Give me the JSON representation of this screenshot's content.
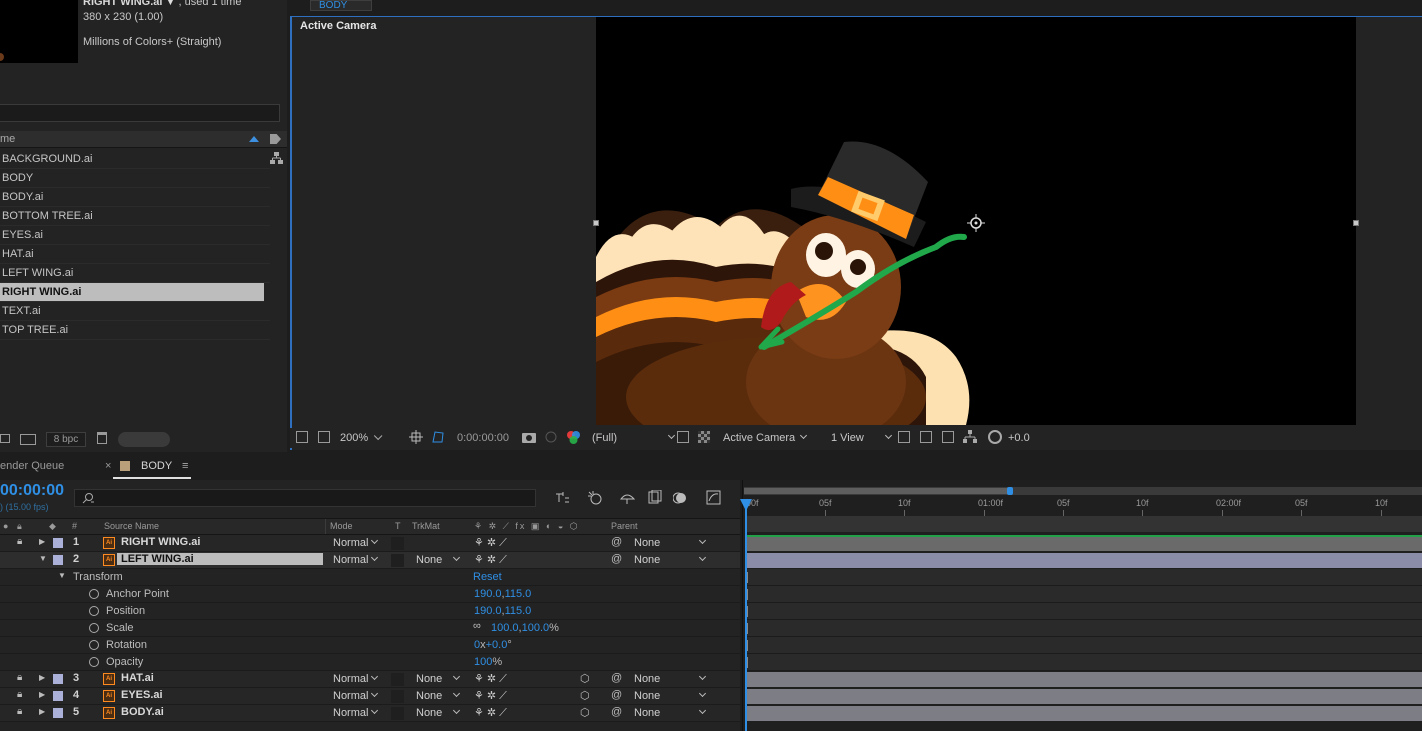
{
  "project": {
    "selected_name": "RIGHT WING.ai",
    "used_text": ", used 1 time",
    "dimensions": "380 x 230 (1.00)",
    "colors": "Millions of Colors+ (Straight)",
    "column_name": "me",
    "items": [
      "BACKGROUND.ai",
      "BODY",
      "BODY.ai",
      "BOTTOM TREE.ai",
      "EYES.ai",
      "HAT.ai",
      "LEFT WING.ai",
      "RIGHT WING.ai",
      "TEXT.ai",
      "TOP TREE.ai"
    ],
    "bpc": "8 bpc"
  },
  "viewer": {
    "comp_tab": "BODY",
    "view_label": "Active Camera",
    "zoom": "200%",
    "timecode": "0:00:00:00",
    "resolution": "(Full)",
    "camera": "Active Camera",
    "views": "1 View",
    "exposure": "+0.0"
  },
  "timeline": {
    "render_queue_tab": "ender Queue",
    "close_glyph": "×",
    "comp_tab": "BODY",
    "menu_glyph": "≡",
    "timecode": "00:00:00",
    "fps": ") (15.00 fps)",
    "columns": {
      "num": "#",
      "source": "Source Name",
      "mode": "Mode",
      "t": "T",
      "trkmat": "TrkMat",
      "parent": "Parent"
    },
    "layers": [
      {
        "num": "1",
        "name": "RIGHT WING.ai",
        "mode": "Normal",
        "trkmat": "",
        "parent": "None"
      },
      {
        "num": "2",
        "name": "LEFT WING.ai",
        "mode": "Normal",
        "trkmat": "None",
        "parent": "None"
      },
      {
        "num": "3",
        "name": "HAT.ai",
        "mode": "Normal",
        "trkmat": "None",
        "parent": "None"
      },
      {
        "num": "4",
        "name": "EYES.ai",
        "mode": "Normal",
        "trkmat": "None",
        "parent": "None"
      },
      {
        "num": "5",
        "name": "BODY.ai",
        "mode": "Normal",
        "trkmat": "None",
        "parent": "None"
      }
    ],
    "transform": {
      "label": "Transform",
      "reset": "Reset",
      "anchor_label": "Anchor Point",
      "anchor_x": "190.0",
      "anchor_y": "115.0",
      "position_label": "Position",
      "position_x": "190.0",
      "position_y": "115.0",
      "scale_label": "Scale",
      "scale_x": "100.0",
      "scale_y": "100.0",
      "scale_unit": "%",
      "rotation_label": "Rotation",
      "rotation_turns": "0",
      "rotation_x": "x",
      "rotation_deg": "+0.0",
      "rotation_unit": "°",
      "opacity_label": "Opacity",
      "opacity": "100",
      "opacity_unit": "%"
    },
    "ruler": [
      "00f",
      "05f",
      "10f",
      "01:00f",
      "05f",
      "10f",
      "02:00f",
      "05f",
      "10f"
    ]
  }
}
